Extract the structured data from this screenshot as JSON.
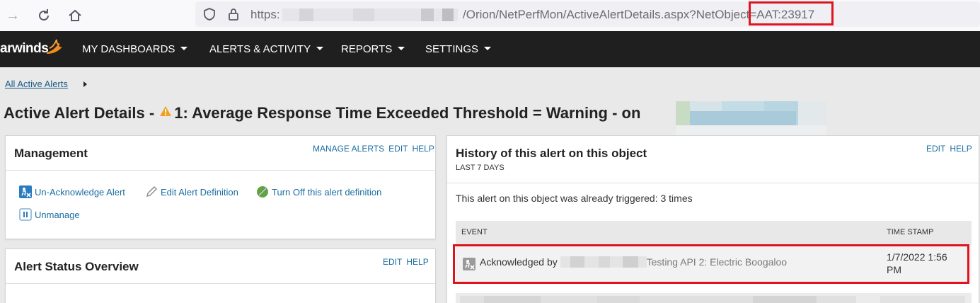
{
  "browser": {
    "back_icon": "arrow-right-icon",
    "reload_icon": "reload-icon",
    "home_icon": "home-icon",
    "url_prefix": "https:",
    "url_path": "/Orion/NetPerfMon/ActiveAlertDetails.aspx?NetObject=",
    "url_object": "AAT:23917"
  },
  "nav": {
    "logo": "arwinds",
    "items": [
      {
        "label": "MY DASHBOARDS"
      },
      {
        "label": "ALERTS & ACTIVITY"
      },
      {
        "label": "REPORTS"
      },
      {
        "label": "SETTINGS"
      }
    ]
  },
  "breadcrumb": {
    "link": "All Active Alerts"
  },
  "page": {
    "title_prefix": "Active Alert Details - ",
    "title_main": "1: Average Response Time Exceeded Threshold = Warning - on"
  },
  "management": {
    "title": "Management",
    "links": {
      "manage": "MANAGE ALERTS",
      "edit": "EDIT",
      "help": "HELP"
    },
    "actions": {
      "unack": "Un-Acknowledge Alert",
      "edit_def": "Edit Alert Definition",
      "turn_off": "Turn Off this alert definition",
      "unmanage": "Unmanage"
    }
  },
  "status_overview": {
    "title": "Alert Status Overview",
    "links": {
      "edit": "EDIT",
      "help": "HELP"
    }
  },
  "history": {
    "title": "History of this alert on this object",
    "subtitle": "LAST 7 DAYS",
    "links": {
      "edit": "EDIT",
      "help": "HELP"
    },
    "summary": "This alert on this object was already triggered: 3 times",
    "columns": {
      "event": "EVENT",
      "timestamp": "TIME STAMP"
    },
    "rows": [
      {
        "event_prefix": "Acknowledged by",
        "event_desc": "Testing API 2: Electric Boogaloo",
        "timestamp": "1/7/2022 1:56 PM"
      }
    ]
  },
  "colors": {
    "nav_bg": "#1f1f1f",
    "link": "#1a6ea0",
    "highlight": "#e0141e",
    "warning": "#f0a020"
  }
}
